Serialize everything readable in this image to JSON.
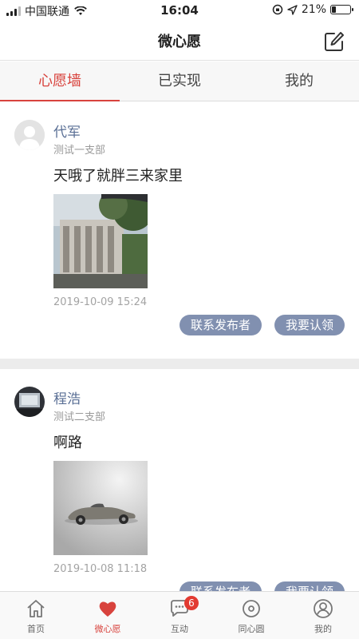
{
  "status_bar": {
    "carrier": "中国联通",
    "time": "16:04",
    "battery_text": "21%",
    "battery_level": 0.21
  },
  "nav": {
    "title": "微心愿",
    "edit_icon": "edit-icon"
  },
  "tabs": [
    {
      "label": "心愿墙",
      "active": true
    },
    {
      "label": "已实现",
      "active": false
    },
    {
      "label": "我的",
      "active": false
    }
  ],
  "posts": [
    {
      "author": "代军",
      "branch": "测试一支部",
      "content": "天哦了就胖三来家里",
      "timestamp": "2019-10-09 15:24",
      "contact_label": "联系发布者",
      "claim_label": "我要认领"
    },
    {
      "author": "程浩",
      "branch": "测试二支部",
      "content": "啊路",
      "timestamp": "2019-10-08 11:18",
      "contact_label": "联系发布者",
      "claim_label": "我要认领"
    }
  ],
  "tab_bar": [
    {
      "label": "首页",
      "icon": "home-icon"
    },
    {
      "label": "微心愿",
      "icon": "heart-icon",
      "active": true
    },
    {
      "label": "互动",
      "icon": "chat-icon",
      "badge": "6"
    },
    {
      "label": "同心圆",
      "icon": "circle-icon"
    },
    {
      "label": "我的",
      "icon": "user-icon"
    }
  ],
  "colors": {
    "accent": "#d8433d",
    "author_name": "#5a6f95",
    "action_pill": "#8190b0",
    "badge": "#e23a31"
  }
}
